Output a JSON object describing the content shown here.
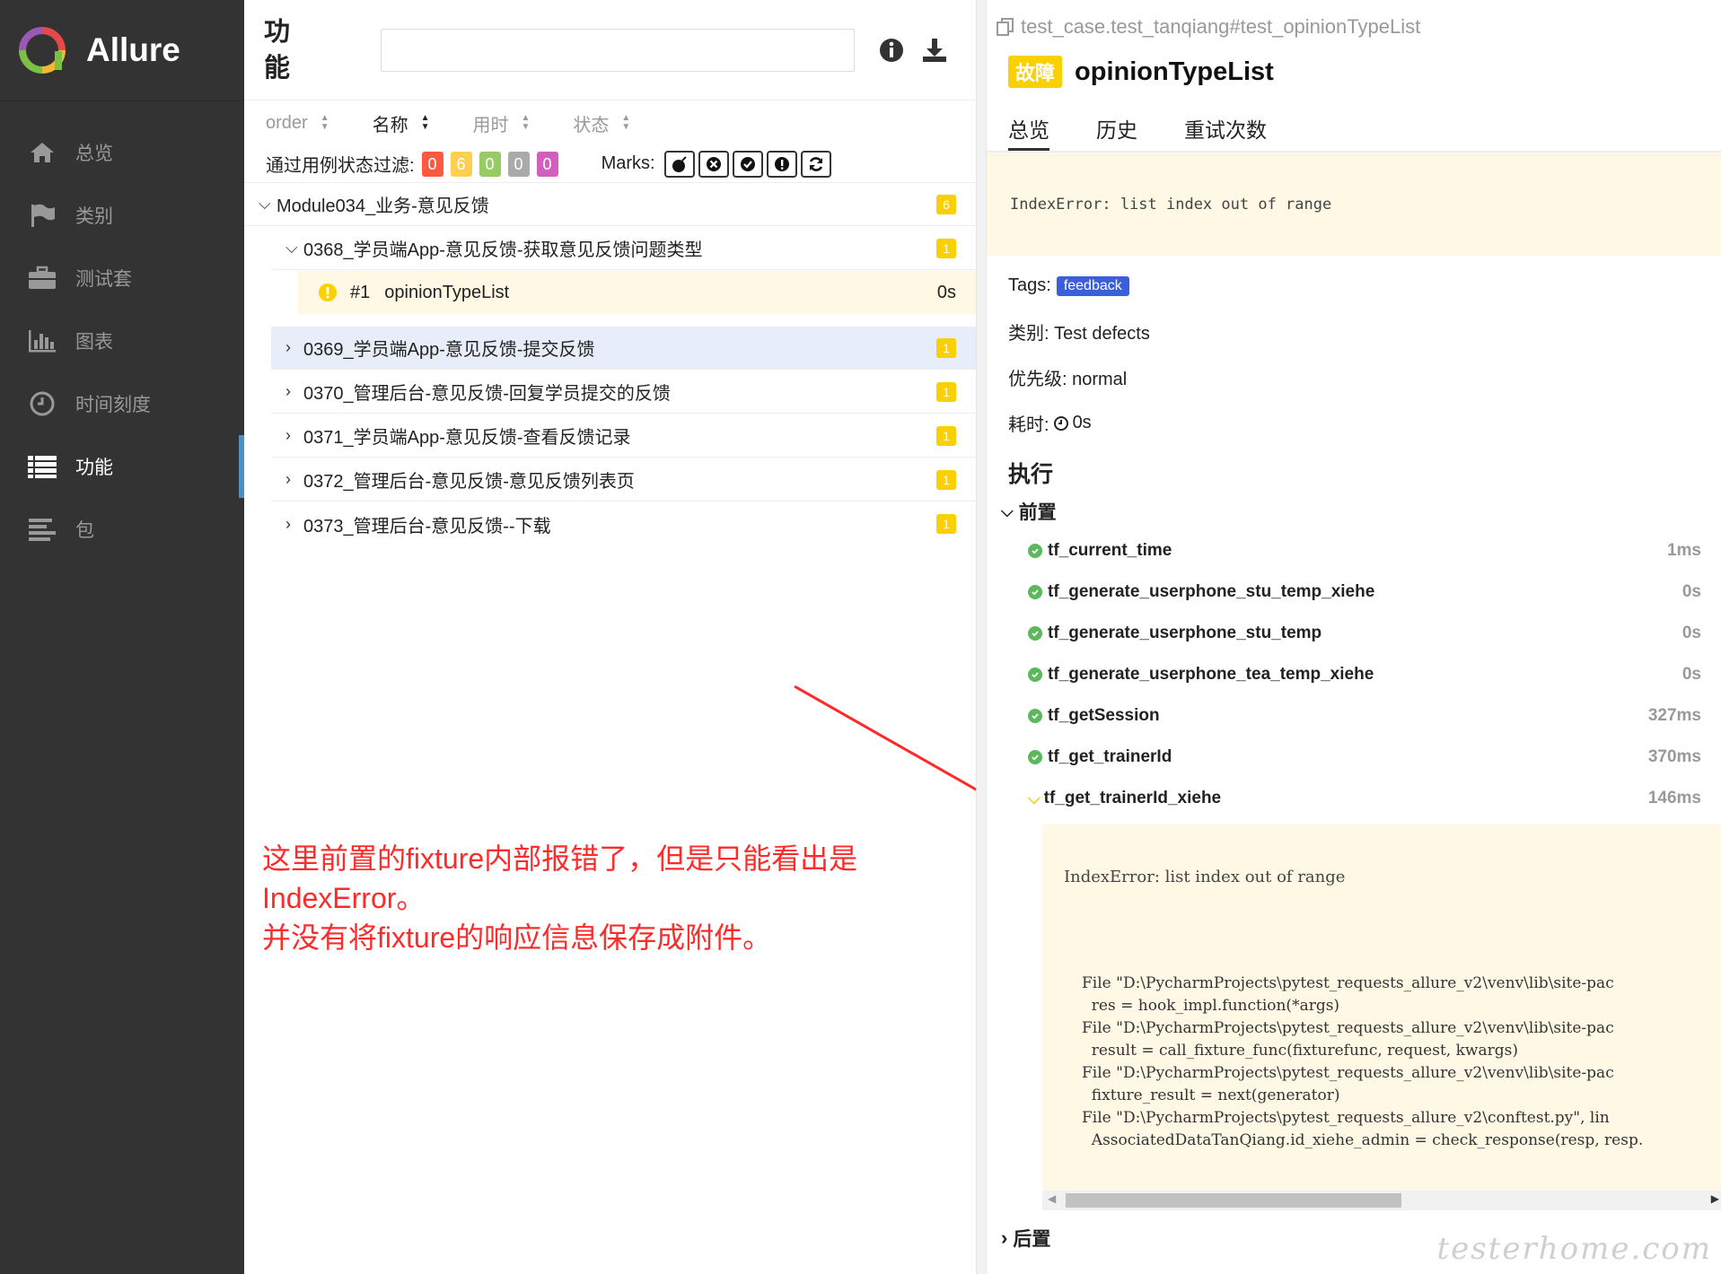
{
  "sidebar": {
    "brand": "Allure",
    "items": [
      {
        "label": "总览",
        "icon": "home-icon"
      },
      {
        "label": "类别",
        "icon": "flag-icon"
      },
      {
        "label": "测试套",
        "icon": "briefcase-icon"
      },
      {
        "label": "图表",
        "icon": "bar-chart-icon"
      },
      {
        "label": "时间刻度",
        "icon": "clock-icon"
      },
      {
        "label": "功能",
        "icon": "list-icon",
        "active": true
      },
      {
        "label": "包",
        "icon": "align-left-icon"
      }
    ]
  },
  "middle": {
    "title_line1": "功",
    "title_line2": "能",
    "search_placeholder": "",
    "sort": {
      "order": "order",
      "name": "名称",
      "duration": "用时",
      "status": "状态"
    },
    "filter_label": "通过用例状态过滤:",
    "filters": [
      {
        "value": "0",
        "color": "#fd5a3e"
      },
      {
        "value": "6",
        "color": "#ffd050"
      },
      {
        "value": "0",
        "color": "#97cc64"
      },
      {
        "value": "0",
        "color": "#aaaaaa"
      },
      {
        "value": "0",
        "color": "#d35ebe"
      }
    ],
    "marks_label": "Marks:",
    "tree": {
      "root": {
        "label": "Module034_业务-意见反馈",
        "count": "6"
      },
      "suite_open": {
        "label": "0368_学员端App-意见反馈-获取意见反馈问题类型",
        "count": "1"
      },
      "case": {
        "number": "#1",
        "label": "opinionTypeList",
        "duration": "0s"
      },
      "suites": [
        {
          "label": "0369_学员端App-意见反馈-提交反馈",
          "count": "1"
        },
        {
          "label": "0370_管理后台-意见反馈-回复学员提交的反馈",
          "count": "1"
        },
        {
          "label": "0371_学员端App-意见反馈-查看反馈记录",
          "count": "1"
        },
        {
          "label": "0372_管理后台-意见反馈-意见反馈列表页",
          "count": "1"
        },
        {
          "label": "0373_管理后台-意见反馈--下载",
          "count": "1"
        }
      ]
    },
    "annotation_line1": "这里前置的fixture内部报错了，但是只能看出是IndexError。",
    "annotation_line2": "并没有将fixture的响应信息保存成附件。"
  },
  "right": {
    "path": "test_case.test_tanqiang#test_opinionTypeList",
    "status": "故障",
    "title": "opinionTypeList",
    "tabs": [
      "总览",
      "历史",
      "重试次数"
    ],
    "error": "IndexError: list index out of range",
    "tags_label": "Tags:",
    "tag": "feedback",
    "category": "类别: Test defects",
    "severity": "优先级: normal",
    "duration_label": "耗时:",
    "duration": "0s",
    "execution": "执行",
    "setup": "前置",
    "teardown": "后置",
    "steps": [
      {
        "name": "tf_current_time",
        "time": "1ms"
      },
      {
        "name": "tf_generate_userphone_stu_temp_xiehe",
        "time": "0s"
      },
      {
        "name": "tf_generate_userphone_stu_temp",
        "time": "0s"
      },
      {
        "name": "tf_generate_userphone_tea_temp_xiehe",
        "time": "0s"
      },
      {
        "name": "tf_getSession",
        "time": "327ms"
      },
      {
        "name": "tf_get_trainerId",
        "time": "370ms"
      }
    ],
    "failed_step": {
      "name": "tf_get_trainerId_xiehe",
      "time": "146ms"
    },
    "failed_message": "IndexError: list index out of range",
    "trace": "File \"D:\\PycharmProjects\\pytest_requests_allure_v2\\venv\\lib\\site-pac\n  res = hook_impl.function(*args)\nFile \"D:\\PycharmProjects\\pytest_requests_allure_v2\\venv\\lib\\site-pac\n  result = call_fixture_func(fixturefunc, request, kwargs)\nFile \"D:\\PycharmProjects\\pytest_requests_allure_v2\\venv\\lib\\site-pac\n  fixture_result = next(generator)\nFile \"D:\\PycharmProjects\\pytest_requests_allure_v2\\conftest.py\", lin\n  AssociatedDataTanQiang.id_xiehe_admin = check_response(resp, resp.",
    "watermark": "testerhome.com"
  }
}
